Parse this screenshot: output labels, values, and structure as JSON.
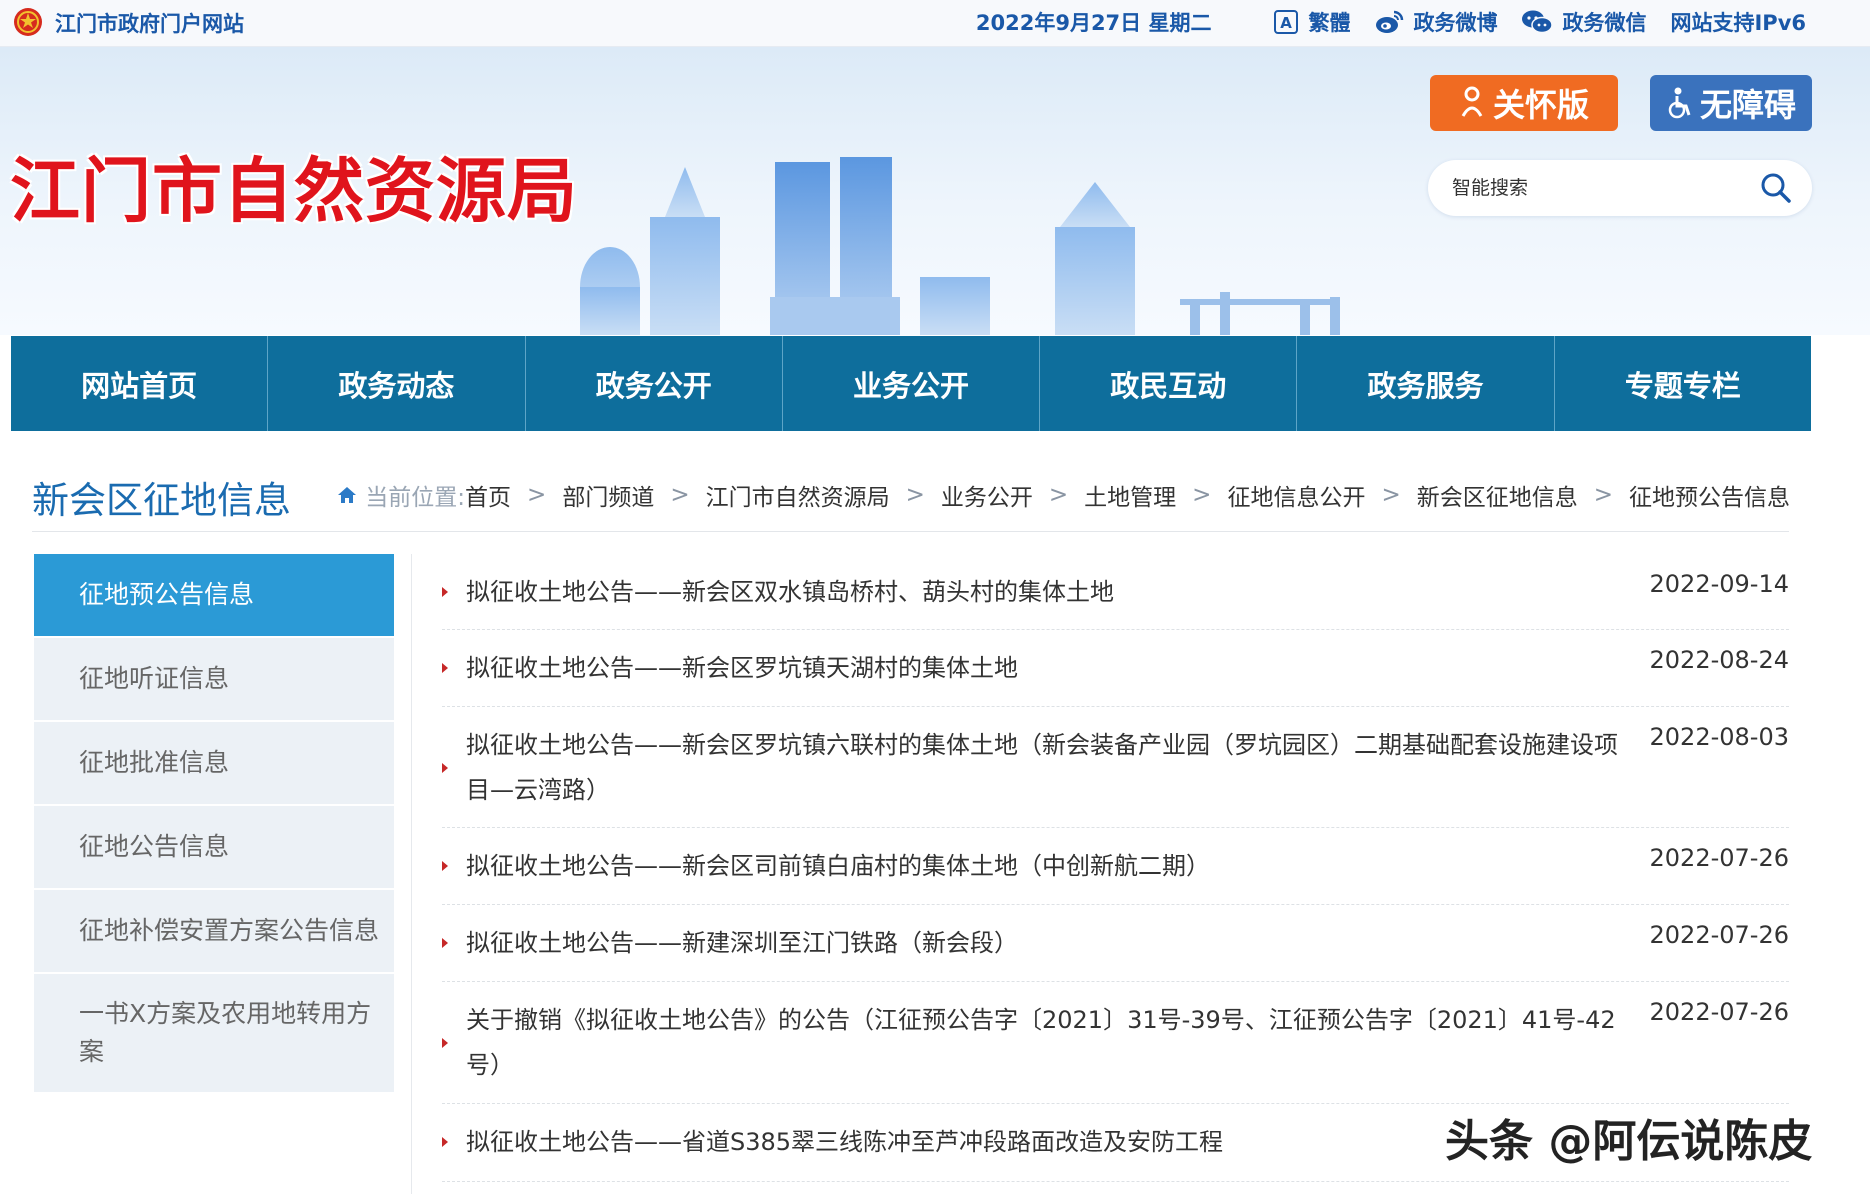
{
  "topbar": {
    "site_link": "江门市政府门户网站",
    "date": "2022年9月27日 星期二",
    "items": [
      {
        "label": "繁體",
        "icon": "traditional-chinese-icon"
      },
      {
        "label": "政务微博",
        "icon": "weibo-icon"
      },
      {
        "label": "政务微信",
        "icon": "wechat-icon"
      },
      {
        "label": "网站支持IPv6",
        "icon": ""
      }
    ]
  },
  "banner": {
    "site_title": "江门市自然资源局",
    "care_button": "关怀版",
    "accessibility_button": "无障碍",
    "search_placeholder": "智能搜索"
  },
  "nav": {
    "items": [
      "网站首页",
      "政务动态",
      "政务公开",
      "业务公开",
      "政民互动",
      "政务服务",
      "专题专栏"
    ]
  },
  "page": {
    "section_title": "新会区征地信息",
    "breadcrumb_label": "当前位置:",
    "breadcrumb": [
      "首页",
      "部门频道",
      "江门市自然资源局",
      "业务公开",
      "土地管理",
      "征地信息公开",
      "新会区征地信息",
      "征地预公告信息"
    ]
  },
  "sidebar": {
    "items": [
      {
        "label": "征地预公告信息",
        "active": true
      },
      {
        "label": "征地听证信息",
        "active": false
      },
      {
        "label": "征地批准信息",
        "active": false
      },
      {
        "label": "征地公告信息",
        "active": false
      },
      {
        "label": "征地补偿安置方案公告信息",
        "active": false
      },
      {
        "label": "一书X方案及农用地转用方案",
        "active": false
      }
    ]
  },
  "list": {
    "rows": [
      {
        "title": "拟征收土地公告——新会区双水镇岛桥村、葫头村的集体土地",
        "date": "2022-09-14"
      },
      {
        "title": "拟征收土地公告——新会区罗坑镇天湖村的集体土地",
        "date": "2022-08-24"
      },
      {
        "title": "拟征收土地公告——新会区罗坑镇六联村的集体土地（新会装备产业园（罗坑园区）二期基础配套设施建设项目—云湾路）",
        "date": "2022-08-03"
      },
      {
        "title": "拟征收土地公告——新会区司前镇白庙村的集体土地（中创新航二期）",
        "date": "2022-07-26"
      },
      {
        "title": "拟征收土地公告——新建深圳至江门铁路（新会段）",
        "date": "2022-07-26"
      },
      {
        "title": "关于撤销《拟征收土地公告》的公告（江征预公告字〔2021〕31号-39号、江征预公告字〔2021〕41号-42号）",
        "date": "2022-07-26"
      },
      {
        "title": "拟征收土地公告——省道S385翠三线陈冲至芦冲段路面改造及安防工程",
        "date": ""
      }
    ]
  },
  "watermark": "头条 @阿伝说陈皮",
  "colors": {
    "brand_blue": "#1a58a8",
    "title_red": "#e0141c",
    "nav_bg": "#0e6e9c",
    "care_orange": "#f06b22",
    "access_blue": "#3a72bd",
    "sidebar_active": "#2b9ad6",
    "bullet_red": "#c62828"
  }
}
